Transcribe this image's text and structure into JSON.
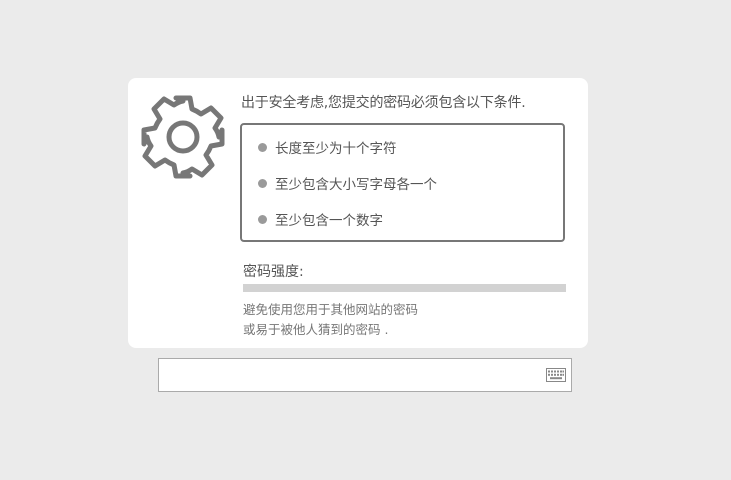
{
  "heading": "出于安全考虑,您提交的密码必须包含以下条件.",
  "rules": [
    "长度至少为十个字符",
    "至少包含大小写字母各一个",
    "至少包含一个数字"
  ],
  "strength": {
    "label": "密码强度:",
    "level": 0
  },
  "hints": [
    "避免使用您用于其他网站的密码",
    "或易于被他人猜到的密码 ."
  ],
  "password_input": {
    "value": "",
    "placeholder": ""
  },
  "icons": {
    "settings": "gear-icon",
    "keyboard": "keyboard-icon",
    "bullet": "bullet-icon"
  },
  "colors": {
    "background": "#ebebeb",
    "card": "#ffffff",
    "text": "#555555",
    "bar": "#d2d2d2"
  }
}
